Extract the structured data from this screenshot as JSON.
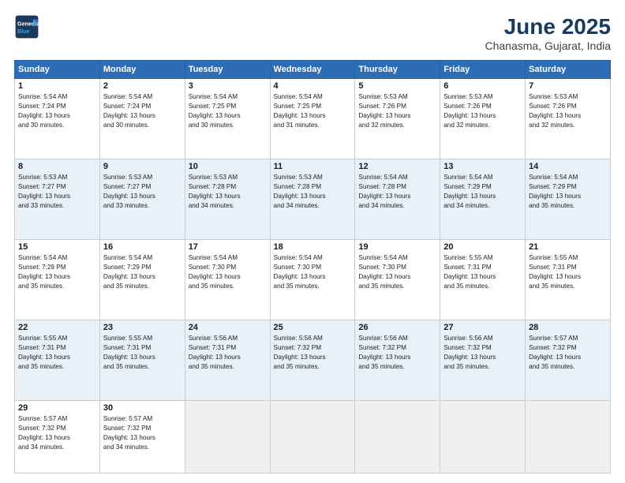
{
  "header": {
    "logo_line1": "General",
    "logo_line2": "Blue",
    "month_year": "June 2025",
    "location": "Chanasma, Gujarat, India"
  },
  "weekdays": [
    "Sunday",
    "Monday",
    "Tuesday",
    "Wednesday",
    "Thursday",
    "Friday",
    "Saturday"
  ],
  "rows": [
    [
      {
        "day": "1",
        "lines": [
          "Sunrise: 5:54 AM",
          "Sunset: 7:24 PM",
          "Daylight: 13 hours",
          "and 30 minutes."
        ]
      },
      {
        "day": "2",
        "lines": [
          "Sunrise: 5:54 AM",
          "Sunset: 7:24 PM",
          "Daylight: 13 hours",
          "and 30 minutes."
        ]
      },
      {
        "day": "3",
        "lines": [
          "Sunrise: 5:54 AM",
          "Sunset: 7:25 PM",
          "Daylight: 13 hours",
          "and 30 minutes."
        ]
      },
      {
        "day": "4",
        "lines": [
          "Sunrise: 5:54 AM",
          "Sunset: 7:25 PM",
          "Daylight: 13 hours",
          "and 31 minutes."
        ]
      },
      {
        "day": "5",
        "lines": [
          "Sunrise: 5:53 AM",
          "Sunset: 7:26 PM",
          "Daylight: 13 hours",
          "and 32 minutes."
        ]
      },
      {
        "day": "6",
        "lines": [
          "Sunrise: 5:53 AM",
          "Sunset: 7:26 PM",
          "Daylight: 13 hours",
          "and 32 minutes."
        ]
      },
      {
        "day": "7",
        "lines": [
          "Sunrise: 5:53 AM",
          "Sunset: 7:26 PM",
          "Daylight: 13 hours",
          "and 32 minutes."
        ]
      }
    ],
    [
      {
        "day": "8",
        "lines": [
          "Sunrise: 5:53 AM",
          "Sunset: 7:27 PM",
          "Daylight: 13 hours",
          "and 33 minutes."
        ]
      },
      {
        "day": "9",
        "lines": [
          "Sunrise: 5:53 AM",
          "Sunset: 7:27 PM",
          "Daylight: 13 hours",
          "and 33 minutes."
        ]
      },
      {
        "day": "10",
        "lines": [
          "Sunrise: 5:53 AM",
          "Sunset: 7:28 PM",
          "Daylight: 13 hours",
          "and 34 minutes."
        ]
      },
      {
        "day": "11",
        "lines": [
          "Sunrise: 5:53 AM",
          "Sunset: 7:28 PM",
          "Daylight: 13 hours",
          "and 34 minutes."
        ]
      },
      {
        "day": "12",
        "lines": [
          "Sunrise: 5:54 AM",
          "Sunset: 7:28 PM",
          "Daylight: 13 hours",
          "and 34 minutes."
        ]
      },
      {
        "day": "13",
        "lines": [
          "Sunrise: 5:54 AM",
          "Sunset: 7:29 PM",
          "Daylight: 13 hours",
          "and 34 minutes."
        ]
      },
      {
        "day": "14",
        "lines": [
          "Sunrise: 5:54 AM",
          "Sunset: 7:29 PM",
          "Daylight: 13 hours",
          "and 35 minutes."
        ]
      }
    ],
    [
      {
        "day": "15",
        "lines": [
          "Sunrise: 5:54 AM",
          "Sunset: 7:29 PM",
          "Daylight: 13 hours",
          "and 35 minutes."
        ]
      },
      {
        "day": "16",
        "lines": [
          "Sunrise: 5:54 AM",
          "Sunset: 7:29 PM",
          "Daylight: 13 hours",
          "and 35 minutes."
        ]
      },
      {
        "day": "17",
        "lines": [
          "Sunrise: 5:54 AM",
          "Sunset: 7:30 PM",
          "Daylight: 13 hours",
          "and 35 minutes."
        ]
      },
      {
        "day": "18",
        "lines": [
          "Sunrise: 5:54 AM",
          "Sunset: 7:30 PM",
          "Daylight: 13 hours",
          "and 35 minutes."
        ]
      },
      {
        "day": "19",
        "lines": [
          "Sunrise: 5:54 AM",
          "Sunset: 7:30 PM",
          "Daylight: 13 hours",
          "and 35 minutes."
        ]
      },
      {
        "day": "20",
        "lines": [
          "Sunrise: 5:55 AM",
          "Sunset: 7:31 PM",
          "Daylight: 13 hours",
          "and 35 minutes."
        ]
      },
      {
        "day": "21",
        "lines": [
          "Sunrise: 5:55 AM",
          "Sunset: 7:31 PM",
          "Daylight: 13 hours",
          "and 35 minutes."
        ]
      }
    ],
    [
      {
        "day": "22",
        "lines": [
          "Sunrise: 5:55 AM",
          "Sunset: 7:31 PM",
          "Daylight: 13 hours",
          "and 35 minutes."
        ]
      },
      {
        "day": "23",
        "lines": [
          "Sunrise: 5:55 AM",
          "Sunset: 7:31 PM",
          "Daylight: 13 hours",
          "and 35 minutes."
        ]
      },
      {
        "day": "24",
        "lines": [
          "Sunrise: 5:56 AM",
          "Sunset: 7:31 PM",
          "Daylight: 13 hours",
          "and 35 minutes."
        ]
      },
      {
        "day": "25",
        "lines": [
          "Sunrise: 5:56 AM",
          "Sunset: 7:32 PM",
          "Daylight: 13 hours",
          "and 35 minutes."
        ]
      },
      {
        "day": "26",
        "lines": [
          "Sunrise: 5:56 AM",
          "Sunset: 7:32 PM",
          "Daylight: 13 hours",
          "and 35 minutes."
        ]
      },
      {
        "day": "27",
        "lines": [
          "Sunrise: 5:56 AM",
          "Sunset: 7:32 PM",
          "Daylight: 13 hours",
          "and 35 minutes."
        ]
      },
      {
        "day": "28",
        "lines": [
          "Sunrise: 5:57 AM",
          "Sunset: 7:32 PM",
          "Daylight: 13 hours",
          "and 35 minutes."
        ]
      }
    ],
    [
      {
        "day": "29",
        "lines": [
          "Sunrise: 5:57 AM",
          "Sunset: 7:32 PM",
          "Daylight: 13 hours",
          "and 34 minutes."
        ]
      },
      {
        "day": "30",
        "lines": [
          "Sunrise: 5:57 AM",
          "Sunset: 7:32 PM",
          "Daylight: 13 hours",
          "and 34 minutes."
        ]
      },
      {
        "day": "",
        "lines": []
      },
      {
        "day": "",
        "lines": []
      },
      {
        "day": "",
        "lines": []
      },
      {
        "day": "",
        "lines": []
      },
      {
        "day": "",
        "lines": []
      }
    ]
  ]
}
